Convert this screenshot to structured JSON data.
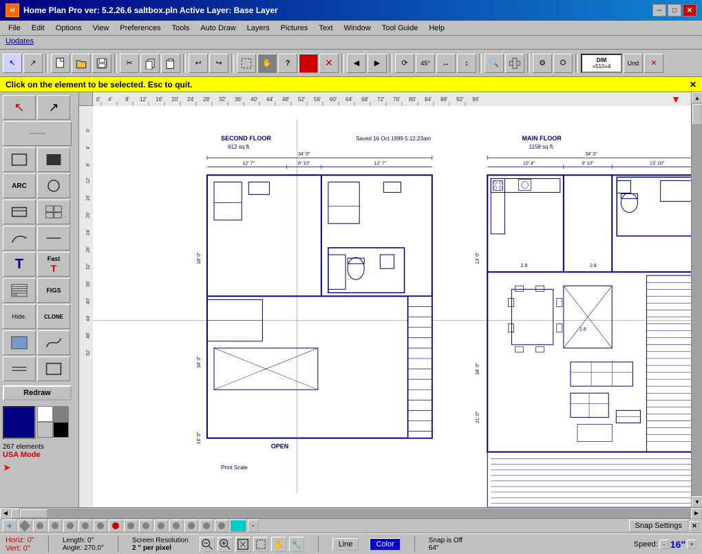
{
  "titlebar": {
    "title": "Home Plan Pro ver: 5.2.26.6   saltbox.pln        Active Layer: Base Layer",
    "min_label": "─",
    "max_label": "□",
    "close_label": "✕"
  },
  "menubar": {
    "items": [
      "File",
      "Edit",
      "Options",
      "View",
      "Preferences",
      "Tools",
      "Auto Draw",
      "Layers",
      "Pictures",
      "Text",
      "Window",
      "Tool Guide",
      "Help"
    ]
  },
  "updates": {
    "label": "Updates"
  },
  "infobar": {
    "message": "Click on the element to be selected.  Esc to quit."
  },
  "left_toolbar": {
    "tools": [
      {
        "name": "select",
        "icon": "↖",
        "label": ""
      },
      {
        "name": "pointer",
        "icon": "↗",
        "label": ""
      },
      {
        "name": "line",
        "icon": "─",
        "label": ""
      },
      {
        "name": "dim",
        "label": "DIM\n»510»4"
      },
      {
        "name": "rect-outline",
        "icon": "▭",
        "label": ""
      },
      {
        "name": "rect-fill",
        "icon": "■",
        "label": ""
      },
      {
        "name": "arc",
        "icon": "ARC",
        "label": ""
      },
      {
        "name": "circle",
        "icon": "○",
        "label": ""
      },
      {
        "name": "rect-b",
        "icon": "⊓",
        "label": ""
      },
      {
        "name": "grid",
        "icon": "⊞",
        "label": ""
      },
      {
        "name": "curve",
        "icon": "∫",
        "label": ""
      },
      {
        "name": "line2",
        "icon": "—",
        "label": ""
      },
      {
        "name": "text",
        "icon": "T",
        "label": ""
      },
      {
        "name": "fast-text",
        "icon": "T",
        "label": "Fast"
      },
      {
        "name": "fill",
        "icon": "Fill",
        "label": ""
      },
      {
        "name": "figs",
        "icon": "FIGS",
        "label": ""
      },
      {
        "name": "hide",
        "icon": "Hide.",
        "label": ""
      },
      {
        "name": "clone",
        "icon": "CLONE",
        "label": ""
      },
      {
        "name": "water",
        "icon": "≈",
        "label": ""
      },
      {
        "name": "curve2",
        "icon": "∫",
        "label": ""
      },
      {
        "name": "line3",
        "icon": "═",
        "label": ""
      },
      {
        "name": "rect2",
        "icon": "▭",
        "label": ""
      }
    ]
  },
  "redraw": {
    "label": "Redraw"
  },
  "status": {
    "elements": "267 elements",
    "mode": "USA Mode",
    "horiz": "Horiz: 0\"",
    "vert": "Vert: 0\"",
    "length": "Length:  0\"",
    "angle": "Angle:  270.0°",
    "screen_res_label": "Screen Resolution",
    "screen_res_value": "2 \" per pixel",
    "line_label": "Line",
    "color_label": "Color",
    "snap_label": "Snap is Off",
    "snap_value": "64\"",
    "speed_label": "Speed:",
    "speed_value": "16\"",
    "speed_minus": "-",
    "speed_plus": "+"
  },
  "toolbar": {
    "buttons": [
      "new",
      "open",
      "save",
      "cut",
      "copy",
      "paste",
      "undo-arrow-left",
      "undo-arrow-right",
      "select-box",
      "hand",
      "help",
      "paint",
      "delete",
      "left",
      "right",
      "rotate",
      "angle45",
      "flip-h",
      "flip-v",
      "more1",
      "more2",
      "undo",
      "close"
    ]
  },
  "yellow_toolbar": {
    "snap_settings": "Snap Settings"
  },
  "floorplan": {
    "second_floor_label": "SECOND FLOOR",
    "second_floor_sqft": "612 sq ft.",
    "main_floor_label": "MAIN FLOOR",
    "main_floor_sqft": "1158 sq ft.",
    "saved_label": "Saved 16 Oct 1999  5:12:23am",
    "open_label": "OPEN",
    "print_scale_label": "Print Scale",
    "dim_34_0": "34' 0\"",
    "dim_12_7_left": "12' 7\"",
    "dim_8_10": "8' 10\"",
    "dim_12_7_right": "12' 7\"",
    "dim_18_0": "18' 0\"",
    "dim_34_0_right": "34' 0\"",
    "dim_10_4": "10' 4\"",
    "dim_9_10": "9' 10\"",
    "dim_13_10": "13' 10\"",
    "dim_16_0": "16' 0\"",
    "dim_34_0_vert": "34' 0\"",
    "dim_13_0": "13' 0\"",
    "dim_21_0": "21' 0\""
  }
}
